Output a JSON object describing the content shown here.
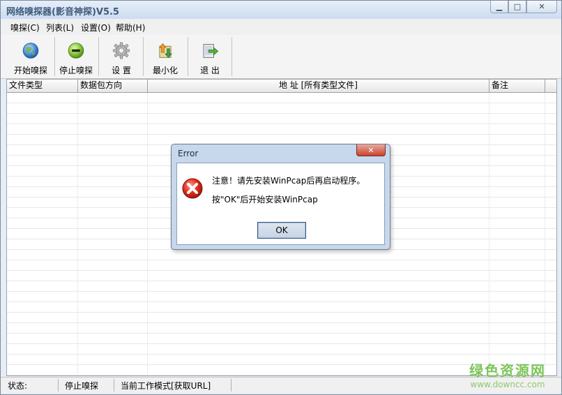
{
  "window": {
    "title": "网络嗅探器(影音神探)V5.5",
    "min_glyph": "▁",
    "max_glyph": "□",
    "close_glyph": "✕"
  },
  "menu": [
    {
      "label": "嗅探(C)"
    },
    {
      "label": "列表(L)"
    },
    {
      "label": "设置(O)"
    },
    {
      "label": "帮助(H)"
    }
  ],
  "toolbar": [
    {
      "label": "开始嗅探",
      "icon": "globe-icon"
    },
    {
      "label": "停止嗅探",
      "icon": "stop-icon"
    },
    {
      "label": "设 置",
      "icon": "gear-icon"
    },
    {
      "label": "最小化",
      "icon": "minimize-arrows-icon"
    },
    {
      "label": "退 出",
      "icon": "exit-icon"
    }
  ],
  "table": {
    "columns": [
      "文件类型",
      "数据包方向",
      "地    址 [所有类型文件]",
      "备注"
    ]
  },
  "status": {
    "label": "状态:",
    "state": "停止嗅探",
    "mode": "当前工作模式[获取URL]"
  },
  "watermark": {
    "text": "绿色资源网",
    "url": "www.downcc.com",
    "color": "#7dc45a"
  },
  "dialog": {
    "title": "Error",
    "close_glyph": "✕",
    "message1": "注意！请先安装WinPcap后再启动程序。",
    "message2": "按\"OK\"后开始安装WinPcap",
    "ok_label": "OK",
    "icon": "error-icon",
    "error_color": "#d02020"
  }
}
